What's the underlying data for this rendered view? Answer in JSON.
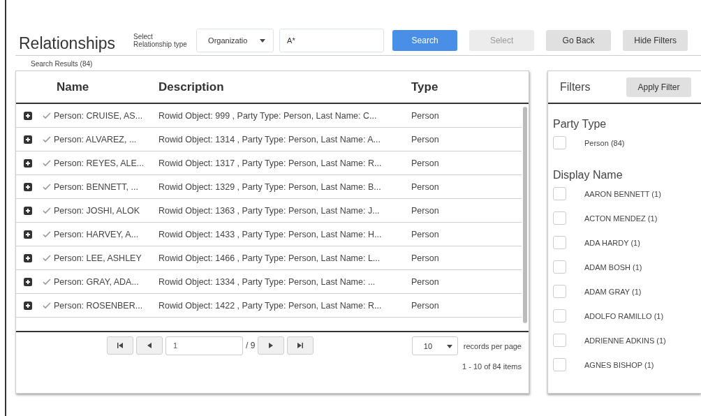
{
  "title": "Relationships",
  "relationship_type": {
    "label": "Select Relationship type",
    "value": "Organizatio"
  },
  "search_field": {
    "value": "A*"
  },
  "buttons": [
    {
      "label": "Search",
      "kind": "primary",
      "disabled": false
    },
    {
      "label": "Select",
      "kind": "plain",
      "disabled": true
    },
    {
      "label": "Go Back",
      "kind": "plain",
      "disabled": false
    },
    {
      "label": "Hide Filters",
      "kind": "plain",
      "disabled": false
    }
  ],
  "results_label": "Search Results (84)",
  "table": {
    "columns": [
      "Name",
      "Description",
      "Type"
    ],
    "rows": [
      {
        "name": "Person: CRUISE, AS...",
        "description": "Rowid Object: 999 , Party Type: Person, Last Name: C...",
        "type": "Person"
      },
      {
        "name": "Person: ALVAREZ, ...",
        "description": "Rowid Object: 1314 , Party Type: Person, Last Name: A...",
        "type": "Person"
      },
      {
        "name": "Person: REYES, ALE...",
        "description": "Rowid Object: 1317 , Party Type: Person, Last Name: R...",
        "type": "Person"
      },
      {
        "name": "Person: BENNETT, ...",
        "description": "Rowid Object: 1329 , Party Type: Person, Last Name: B...",
        "type": "Person"
      },
      {
        "name": "Person: JOSHI, ALOK",
        "description": "Rowid Object: 1363 , Party Type: Person, Last Name: J...",
        "type": "Person"
      },
      {
        "name": "Person: HARVEY, A...",
        "description": "Rowid Object: 1433 , Party Type: Person, Last Name: H...",
        "type": "Person"
      },
      {
        "name": "Person: LEE, ASHLEY",
        "description": "Rowid Object: 1466 , Party Type: Person, Last Name: L...",
        "type": "Person"
      },
      {
        "name": "Person: GRAY, ADA...",
        "description": "Rowid Object: 1334 , Party Type: Person, Last Name: ...",
        "type": "Person"
      },
      {
        "name": "Person: ROSENBER...",
        "description": "Rowid Object: 1422 , Party Type: Person, Last Name: R...",
        "type": "Person"
      }
    ]
  },
  "pagination": {
    "page": "1",
    "of": "/ 9",
    "page_size": "10",
    "page_size_label": "records per page",
    "summary": "1 - 10 of 84 items"
  },
  "filters": {
    "title": "Filters",
    "apply": "Apply Filter",
    "groups": [
      {
        "title": "Party Type",
        "options": [
          {
            "label": "Person (84)",
            "checked": false
          }
        ]
      },
      {
        "title": "Display Name",
        "options": [
          {
            "label": "AARON BENNETT (1)",
            "checked": false
          },
          {
            "label": "ACTON MENDEZ (1)",
            "checked": false
          },
          {
            "label": "ADA HARDY (1)",
            "checked": false
          },
          {
            "label": "ADAM BOSH (1)",
            "checked": false
          },
          {
            "label": "ADAM GRAY (1)",
            "checked": false
          },
          {
            "label": "ADOLFO RAMILLO (1)",
            "checked": false
          },
          {
            "label": "ADRIENNE ADKINS (1)",
            "checked": false
          },
          {
            "label": "AGNES BISHOP (1)",
            "checked": false
          }
        ]
      }
    ]
  }
}
